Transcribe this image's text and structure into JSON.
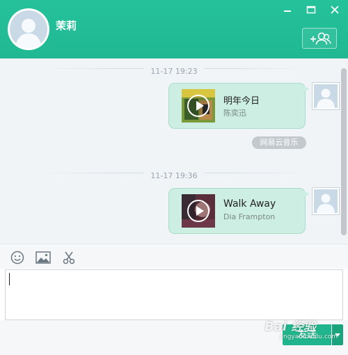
{
  "header": {
    "contact_name": "茉莉"
  },
  "colors": {
    "accent": "#20b58c",
    "bubble": "#cdeee2"
  },
  "messages": [
    {
      "timestamp": "11-17 19:23",
      "song_title": "明年今日",
      "artist": "陈奕迅",
      "source": "网易云音乐"
    },
    {
      "timestamp": "11-17 19:36",
      "song_title": "Walk Away",
      "artist": "Dia Frampton"
    }
  ],
  "toolbar": {
    "icons": [
      "emoji-icon",
      "image-icon",
      "scissors-icon"
    ]
  },
  "input": {
    "value": ""
  },
  "send_button": {
    "label": "发送"
  },
  "watermark": {
    "text": "Bai 经验",
    "url": "jingyan.baidu.com"
  }
}
